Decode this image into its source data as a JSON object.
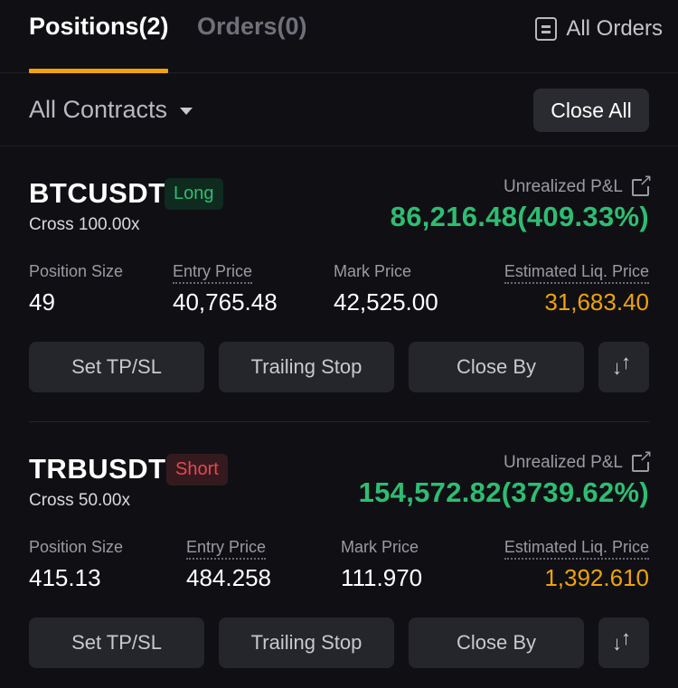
{
  "tabs": {
    "positions": "Positions(2)",
    "orders": "Orders(0)",
    "all_orders": "All Orders",
    "all_orders_icon": "document-list-icon"
  },
  "filter": {
    "contracts_selected": "All Contracts",
    "close_all": "Close All"
  },
  "colors": {
    "accent": "#f0a30a",
    "profit": "#2ebd72",
    "loss": "#e6484f",
    "background": "#101014",
    "button": "#25262b"
  },
  "labels": {
    "unrealized_pnl": "Unrealized P&L",
    "position_size": "Position Size",
    "entry_price": "Entry Price",
    "mark_price": "Mark Price",
    "est_liq_price": "Estimated Liq. Price",
    "set_tpsl": "Set TP/SL",
    "trailing_stop": "Trailing Stop",
    "close_by": "Close By"
  },
  "positions": [
    {
      "symbol": "BTCUSDT",
      "side": "Long",
      "margin_mode": "Cross 100.00x",
      "unrealized_pnl": "86,216.48(409.33%)",
      "position_size": "49",
      "entry_price": "40,765.48",
      "mark_price": "42,525.00",
      "est_liq_price": "31,683.40"
    },
    {
      "symbol": "TRBUSDT",
      "side": "Short",
      "margin_mode": "Cross 50.00x",
      "unrealized_pnl": "154,572.82(3739.62%)",
      "position_size": "415.13",
      "entry_price": "484.258",
      "mark_price": "111.970",
      "est_liq_price": "1,392.610"
    }
  ]
}
